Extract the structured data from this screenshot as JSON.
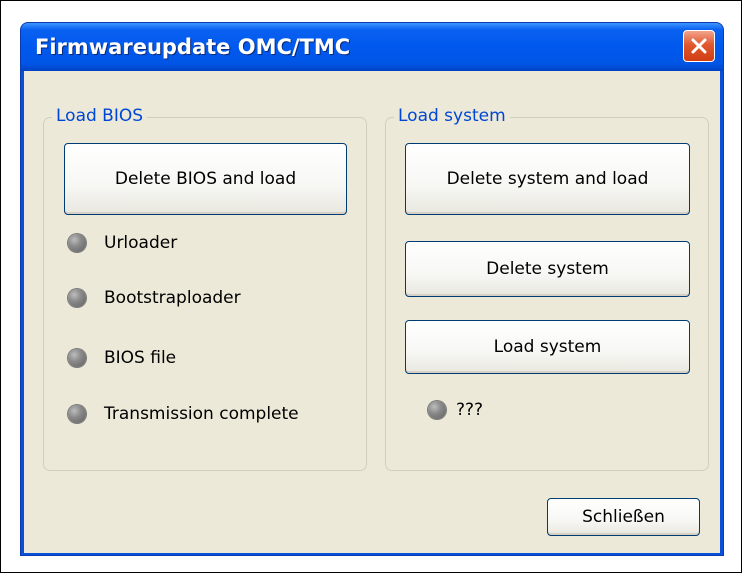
{
  "window": {
    "title": "Firmwareupdate OMC/TMC",
    "close_icon": "close-icon"
  },
  "load_bios": {
    "legend": "Load BIOS",
    "delete_and_load_label": "Delete BIOS and load",
    "statuses": [
      {
        "label": "Urloader",
        "icon": "status-led-icon"
      },
      {
        "label": "Bootstraploader",
        "icon": "status-led-icon"
      },
      {
        "label": "BIOS file",
        "icon": "status-led-icon"
      },
      {
        "label": "Transmission complete",
        "icon": "status-led-icon"
      }
    ]
  },
  "load_system": {
    "legend": "Load system",
    "delete_and_load_label": "Delete system and load",
    "delete_label": "Delete system",
    "load_label": "Load system",
    "status": {
      "label": "???",
      "icon": "status-led-icon"
    }
  },
  "footer": {
    "close_label": "Schließen"
  },
  "colors": {
    "titlebar": "#0058ee",
    "client_background": "#ece9d8",
    "legend_text": "#0046d5",
    "close_button": "#e2582f",
    "led": "#8a8a8a"
  }
}
